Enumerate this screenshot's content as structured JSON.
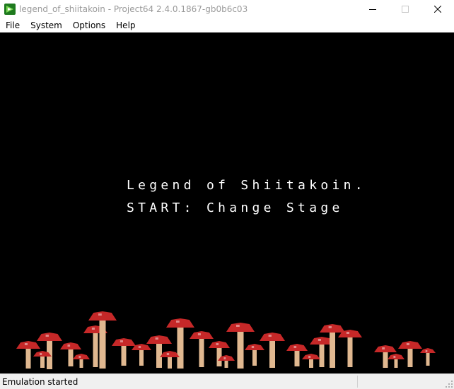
{
  "window": {
    "title": "legend_of_shiitakoin - Project64 2.4.0.1867-gb0b6c03",
    "app_icon": "project64-logo-icon",
    "controls": {
      "minimize": "minimize-icon",
      "maximize": "maximize-icon",
      "close": "close-icon"
    }
  },
  "menu": {
    "items": [
      {
        "label": "File"
      },
      {
        "label": "System"
      },
      {
        "label": "Options"
      },
      {
        "label": "Help"
      }
    ]
  },
  "game": {
    "line1": "Legend of Shiitakoin.",
    "line2": "START: Change Stage",
    "background_color": "#000000",
    "text_color": "#ffffff",
    "mushroom_cap_color": "#c62828",
    "mushroom_stem_color": "#e0b890"
  },
  "status": {
    "text": "Emulation started"
  }
}
